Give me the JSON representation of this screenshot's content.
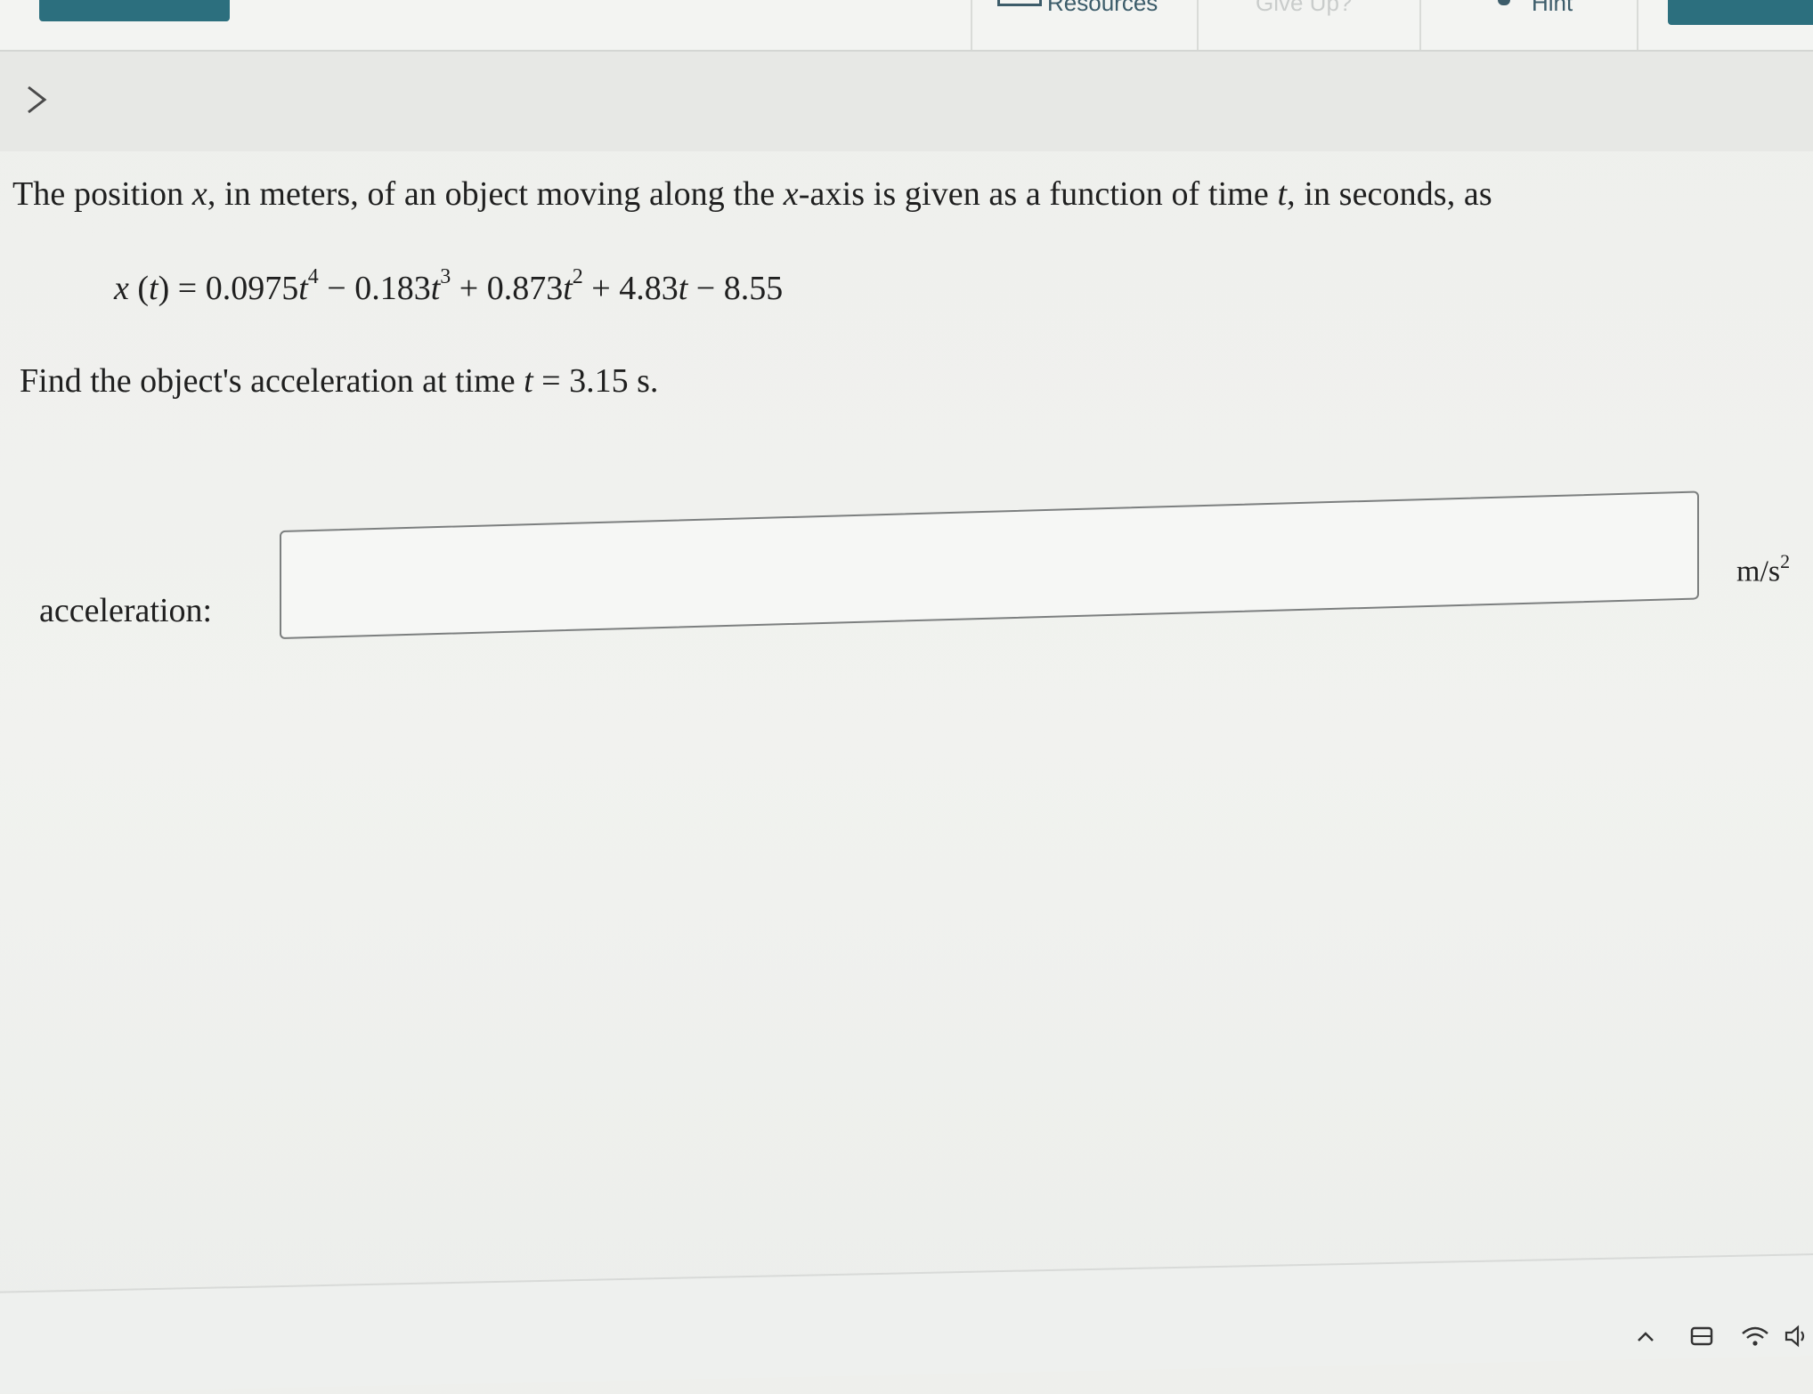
{
  "toolbar": {
    "resources_label": "Resources",
    "give_up_label": "Give Up?",
    "hint_label": "Hint"
  },
  "question": {
    "intro": {
      "p1": "The position ",
      "v1": "x",
      "p2": ", in meters, of an object moving along the ",
      "v2": "x",
      "p3": "-axis is given as a function of time ",
      "v3": "t",
      "p4": ", in seconds, as"
    },
    "equation": {
      "lhs_fn": "x",
      "lhs_open": " (",
      "lhs_var": "t",
      "lhs_close": ") = ",
      "c4": "0.0975",
      "e4": "4",
      "op3": " − ",
      "c3": "0.183",
      "e3": "3",
      "op2": " + ",
      "c2": "0.873",
      "e2": "2",
      "op1": " + ",
      "c1": "4.83",
      "op0": " − ",
      "c0": "8.55",
      "var": "t"
    },
    "find": {
      "p1": "Find the object's acceleration at time ",
      "var": "t",
      "p2": " = 3.15 s."
    }
  },
  "answer": {
    "label": "acceleration:",
    "value": "",
    "unit_base": "m/s",
    "unit_exp": "2"
  }
}
